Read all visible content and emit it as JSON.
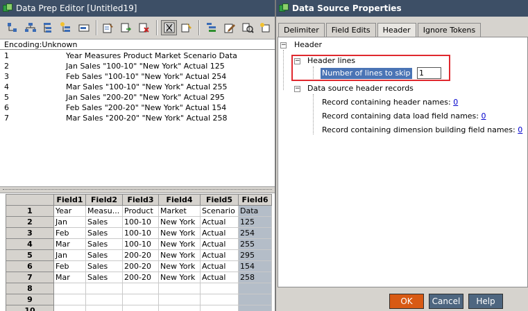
{
  "left_window": {
    "title": "Data Prep Editor [Untitled19]",
    "encoding": "Encoding:Unknown",
    "raw_lines": [
      {
        "num": "1",
        "text": "Year Measures Product Market Scenario Data"
      },
      {
        "num": "2",
        "text": "Jan Sales \"100-10\" \"New York\" Actual 125"
      },
      {
        "num": "3",
        "text": "Feb Sales \"100-10\" \"New York\" Actual 254"
      },
      {
        "num": "4",
        "text": "Mar Sales \"100-10\" \"New York\" Actual 255"
      },
      {
        "num": "5",
        "text": "Jan Sales \"200-20\" \"New York\" Actual 295"
      },
      {
        "num": "6",
        "text": "Feb Sales \"200-20\" \"New York\" Actual 154"
      },
      {
        "num": "7",
        "text": "Mar Sales \"200-20\" \"New York\" Actual 258"
      }
    ],
    "grid": {
      "columns": [
        "Field1",
        "Field2",
        "Field3",
        "Field4",
        "Field5",
        "Field6"
      ],
      "rows": [
        {
          "n": "1",
          "cells": [
            "Year",
            "Measu...",
            "Product",
            "Market",
            "Scenario",
            "Data"
          ]
        },
        {
          "n": "2",
          "cells": [
            "Jan",
            "Sales",
            "100-10",
            "New York",
            "Actual",
            "125"
          ]
        },
        {
          "n": "3",
          "cells": [
            "Feb",
            "Sales",
            "100-10",
            "New York",
            "Actual",
            "254"
          ]
        },
        {
          "n": "4",
          "cells": [
            "Mar",
            "Sales",
            "100-10",
            "New York",
            "Actual",
            "255"
          ]
        },
        {
          "n": "5",
          "cells": [
            "Jan",
            "Sales",
            "200-20",
            "New York",
            "Actual",
            "295"
          ]
        },
        {
          "n": "6",
          "cells": [
            "Feb",
            "Sales",
            "200-20",
            "New York",
            "Actual",
            "154"
          ]
        },
        {
          "n": "7",
          "cells": [
            "Mar",
            "Sales",
            "200-20",
            "New York",
            "Actual",
            "258"
          ]
        },
        {
          "n": "8",
          "cells": [
            "",
            "",
            "",
            "",
            "",
            ""
          ]
        },
        {
          "n": "9",
          "cells": [
            "",
            "",
            "",
            "",
            "",
            ""
          ]
        },
        {
          "n": "10",
          "cells": [
            "",
            "",
            "",
            "",
            "",
            ""
          ]
        }
      ]
    },
    "toolbar_icons": [
      "dimension-build-icon",
      "hierarchy-icon",
      "tree-icon",
      "tree-add-icon",
      "text-field-icon",
      "field-properties-icon",
      "move-field-icon",
      "delete-field-icon",
      "data-source-properties-icon",
      "join-fields-icon",
      "outline-icon",
      "edit-icon",
      "replace-icon",
      "select-reject-icon"
    ]
  },
  "dialog": {
    "title": "Data Source Properties",
    "tabs": [
      "Delimiter",
      "Field Edits",
      "Header",
      "Ignore Tokens"
    ],
    "active_tab": "Header",
    "tree": {
      "header": "Header",
      "header_lines": "Header lines",
      "lines_to_skip_label": "Number of lines to skip",
      "lines_to_skip_value": "1",
      "header_records": "Data source header records",
      "record_header_names": {
        "label": "Record containing header names:",
        "value": "0"
      },
      "record_load_names": {
        "label": "Record containing data load field names:",
        "value": "0"
      },
      "record_dim_names": {
        "label": "Record containing dimension building field names:",
        "value": "0"
      }
    },
    "buttons": {
      "ok": "OK",
      "cancel": "Cancel",
      "help": "Help"
    },
    "colors": {
      "ok": "#d85a14",
      "highlight": "#e0282e",
      "selection": "#4a74b5"
    }
  }
}
